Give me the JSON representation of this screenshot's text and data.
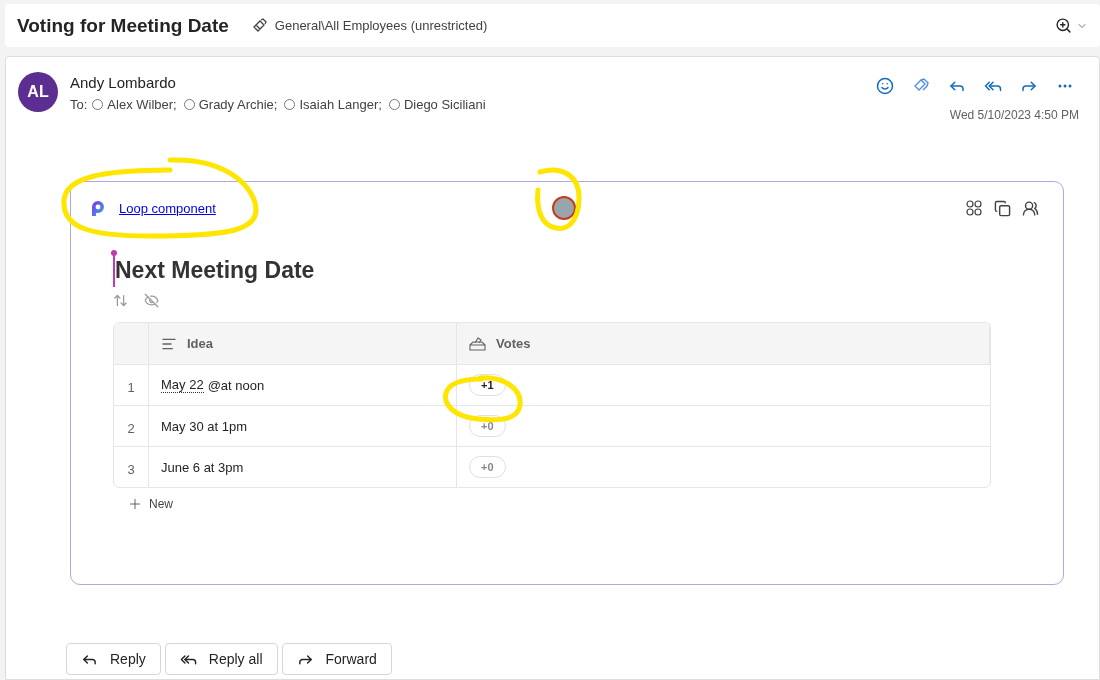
{
  "header": {
    "title": "Voting for Meeting Date",
    "label": "General\\All Employees (unrestricted)"
  },
  "message": {
    "avatar_initials": "AL",
    "sender": "Andy Lombardo",
    "to_label": "To:",
    "recipients": [
      "Alex Wilber;",
      "Grady Archie;",
      "Isaiah Langer;",
      "Diego Siciliani"
    ],
    "date": "Wed 5/10/2023 4:50 PM"
  },
  "loop": {
    "link": "Loop component",
    "title": "Next Meeting Date",
    "table": {
      "columns": [
        {
          "label": "Idea",
          "kind": "text"
        },
        {
          "label": "Votes",
          "kind": "votes"
        }
      ],
      "rows": [
        {
          "number": "1",
          "date_mention": "May 22",
          "idea": "@at noon",
          "votes": "+1",
          "voted": true
        },
        {
          "number": "2",
          "idea": "May 30 at 1pm",
          "votes": "+0",
          "voted": false
        },
        {
          "number": "3",
          "idea": "June 6 at 3pm",
          "votes": "+0",
          "voted": false
        }
      ]
    },
    "new_label": "New"
  },
  "actions": [
    {
      "label": "Reply",
      "kind": "reply"
    },
    {
      "label": "Reply all",
      "kind": "reply_all"
    },
    {
      "label": "Forward",
      "kind": "forward"
    }
  ]
}
